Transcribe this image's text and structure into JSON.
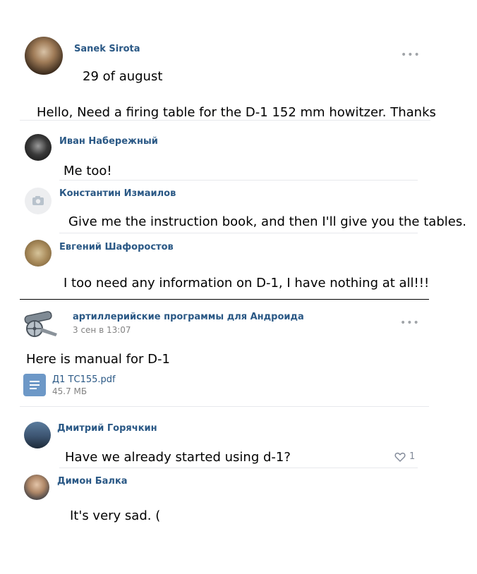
{
  "post": {
    "author": "Sanek Sirota",
    "date": "29 of august",
    "text": "Hello, Need a firing table for the D-1 152 mm howitzer. Thanks",
    "menu_icon": "•••"
  },
  "comments": [
    {
      "author": "Иван Набережный",
      "text": "Me too!"
    },
    {
      "author": "Константин Измаилов",
      "text": "Give me the instruction book, and then I'll give you the tables."
    },
    {
      "author": "Евгений Шафоростов",
      "text": "I too need any information on D-1, I have nothing at all!!!"
    }
  ],
  "repost": {
    "author": "артиллерийские программы для Андроида",
    "date": "3 сен в 13:07",
    "menu_icon": "•••",
    "text": "Here is manual for D-1",
    "attachment": {
      "name": "Д1 ТС155.pdf",
      "size": "45.7 МБ"
    }
  },
  "replies": [
    {
      "author": "Дмитрий Горячкин",
      "text": "Have we already started using d-1?",
      "likes": "1"
    },
    {
      "author": "Димон Балка",
      "text": "It's very sad. ("
    }
  ],
  "colors": {
    "name": "#2a5885",
    "meta": "#828282",
    "doc_icon": "#6d98c7",
    "separator": "#e7e8ec"
  }
}
